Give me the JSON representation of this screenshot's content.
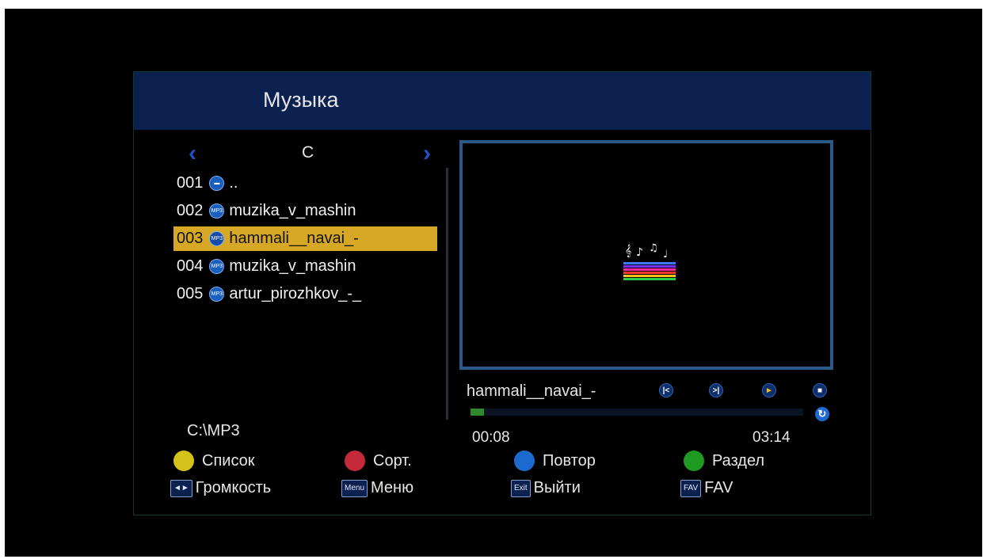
{
  "header": {
    "title": "Музыка"
  },
  "drive": {
    "label": "C"
  },
  "files": [
    {
      "num": "001",
      "name": ".."
    },
    {
      "num": "002",
      "name": "muzika_v_mashin"
    },
    {
      "num": "003",
      "name": "hammali__navai_-"
    },
    {
      "num": "004",
      "name": "muzika_v_mashin"
    },
    {
      "num": "005",
      "name": "artur_pirozhkov_-_"
    }
  ],
  "icons": {
    "folder": "folder-icon",
    "mp3": "MP3"
  },
  "path": "C:\\MP3",
  "player": {
    "track": "hammali__navai_-",
    "elapsed": "00:08",
    "total": "03:14",
    "progress": 0.04,
    "buttons": {
      "prev": "|<",
      "next": ">|",
      "play": "►",
      "stop": "■",
      "repeat": "↻"
    }
  },
  "legend": {
    "yellow": "Список",
    "red": "Сорт.",
    "blue": "Повтор",
    "green": "Раздел",
    "volume": "Громкость",
    "menu_key": "Menu",
    "menu": "Меню",
    "exit_key": "Exit",
    "exit": "Выйти",
    "fav_key": "FAV",
    "fav": "FAV",
    "volume_key": "◄►"
  },
  "colors": {
    "yellow": "#d2c21a",
    "red": "#c42a3a",
    "blue": "#1c6ad0",
    "green": "#1e9a22",
    "highlight": "#d6a825"
  }
}
